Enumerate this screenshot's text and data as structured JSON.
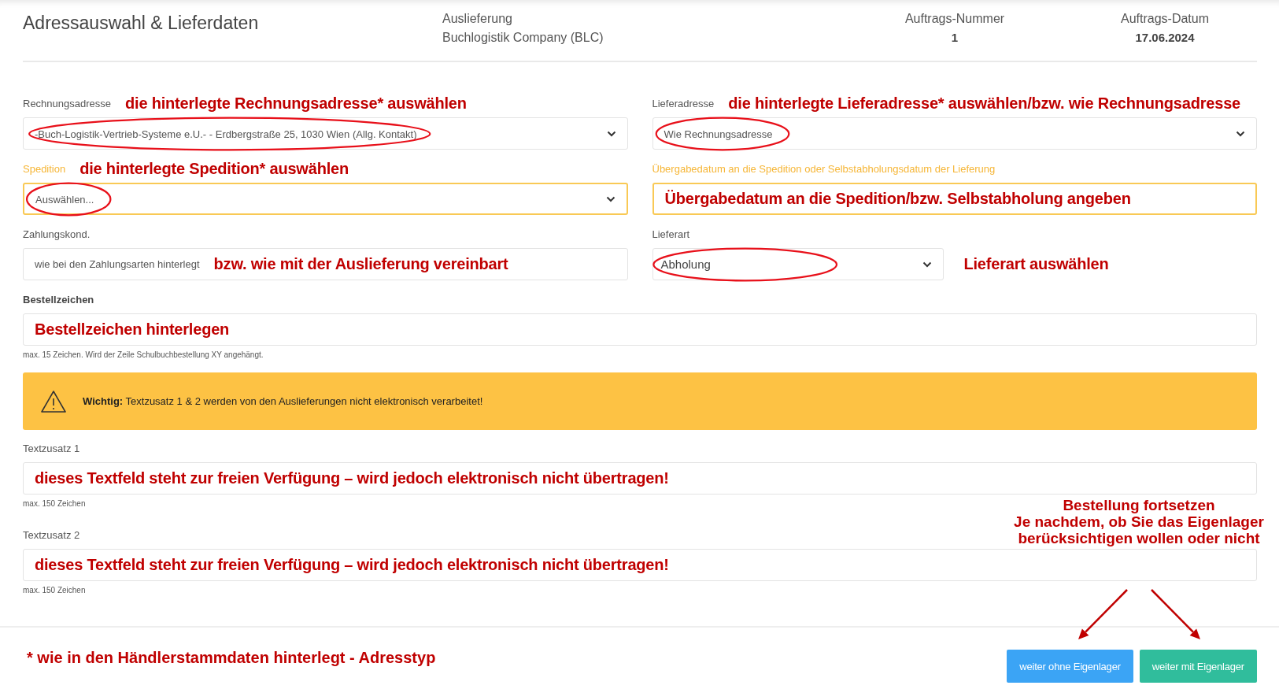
{
  "header": {
    "title": "Adressauswahl & Lieferdaten",
    "info": [
      {
        "kind": "name",
        "label": "Auslieferung",
        "value": "Buchlogistik Company (BLC)"
      },
      {
        "kind": "figure",
        "label": "Auftrags-Nummer",
        "value": "1"
      },
      {
        "kind": "figure",
        "label": "Auftrags-Datum",
        "value": "17.06.2024"
      }
    ]
  },
  "fields": [
    {
      "kind": "select",
      "label": "Rechnungsadresse",
      "value": "-Buch-Logistik-Vertrieb-Systeme e.U.- - Erdbergstraße 25, 1030 Wien (Allg. Kontakt)",
      "invalid": false,
      "circled": true,
      "label_note": "die hinterlegte Rechnungsadresse* auswählen"
    },
    {
      "kind": "select",
      "label": "Lieferadresse",
      "value": "Wie Rechnungsadresse",
      "invalid": false,
      "circled": true,
      "label_note": "die hinterlegte Lieferadresse* auswählen/bzw. wie Rechnungsadresse"
    },
    {
      "kind": "select",
      "label": "Spedition",
      "value": "Auswählen...",
      "invalid": true,
      "circled": true,
      "label_note": "die hinterlegte Spedition* auswählen"
    },
    {
      "kind": "date",
      "label": "Übergabedatum an die Spedition oder Selbstabholungsdatum der Lieferung",
      "invalid": true,
      "inner_note": "Übergabedatum an die Spedition/bzw. Selbstabholung angeben"
    },
    {
      "kind": "text",
      "label": "Zahlungskond.",
      "value": "wie bei den Zahlungsarten hinterlegt",
      "invalid": false,
      "inner_note": "bzw. wie mit der Auslieferung vereinbart"
    },
    {
      "kind": "select",
      "label": "Lieferart",
      "value": "Abholung",
      "invalid": false,
      "circled": true,
      "side_note": "Lieferart auswählen"
    }
  ],
  "order_reference": {
    "label": "Bestellzeichen",
    "inner_note": "Bestellzeichen hinterlegen",
    "hint": "max. 15 Zeichen. Wird der Zeile Schulbuchbestellung XY angehängt."
  },
  "alert": {
    "text": "**Wichtig:** Textzusatz 1 & 2 werden von den Auslieferungen nicht elektronisch verarbeitet!"
  },
  "text_fields": [
    {
      "label": "Textzusatz 1",
      "inner_note": "dieses Textfeld steht zur freien Verfügung – wird jedoch elektronisch nicht übertragen!",
      "hint": "max. 150 Zeichen"
    },
    {
      "label": "Textzusatz 2",
      "inner_note": "dieses Textfeld steht zur freien Verfügung – wird jedoch elektronisch nicht übertragen!",
      "hint": "max. 150 Zeichen"
    }
  ],
  "continue_note": "Bestellung fortsetzen\nJe nachdem, ob Sie das Eigenlager\nberücksichtigen wollen oder nicht",
  "footnote": "* wie in den Händlerstammdaten hinterlegt - Adresstyp",
  "buttons": [
    {
      "label": "weiter ohne Eigenlager",
      "color": "#3ba4f5"
    },
    {
      "label": "weiter mit Eigenlager",
      "color": "#30bd9c"
    }
  ]
}
